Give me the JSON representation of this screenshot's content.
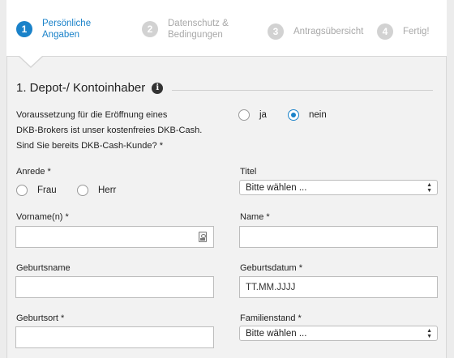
{
  "steps": [
    {
      "number": "1",
      "label_line1": "Persönliche",
      "label_line2": "Angaben",
      "state": "active"
    },
    {
      "number": "2",
      "label_line1": "Datenschutz &",
      "label_line2": "Bedingungen",
      "state": "inactive"
    },
    {
      "number": "3",
      "label_line1": "Antragsübersicht",
      "label_line2": "",
      "state": "inactive"
    },
    {
      "number": "4",
      "label_line1": "Fertig!",
      "label_line2": "",
      "state": "inactive"
    }
  ],
  "section": {
    "title": "1. Depot-/ Kontoinhaber",
    "info_icon": "info-icon"
  },
  "dkb_question": {
    "line1": "Voraussetzung für die Eröffnung eines",
    "line2": "DKB-Brokers ist unser kostenfreies DKB-Cash.",
    "line3": "Sind Sie bereits DKB-Cash-Kunde? *",
    "options": [
      {
        "label": "ja",
        "selected": false
      },
      {
        "label": "nein",
        "selected": true
      }
    ]
  },
  "anrede": {
    "label": "Anrede *",
    "options": [
      {
        "label": "Frau",
        "selected": false
      },
      {
        "label": "Herr",
        "selected": false
      }
    ]
  },
  "titel": {
    "label": "Titel",
    "value": "Bitte wählen ..."
  },
  "vorname": {
    "label": "Vorname(n) *",
    "value": ""
  },
  "name": {
    "label": "Name *",
    "value": ""
  },
  "geburtsname": {
    "label": "Geburtsname",
    "value": ""
  },
  "geburtsdatum": {
    "label": "Geburtsdatum *",
    "placeholder": "TT.MM.JJJJ"
  },
  "geburtsort": {
    "label": "Geburtsort *",
    "value": ""
  },
  "familienstand": {
    "label": "Familienstand *",
    "value": "Bitte wählen ..."
  },
  "colors": {
    "accent": "#1a82c9",
    "inactive_step": "#d2d2d2"
  }
}
